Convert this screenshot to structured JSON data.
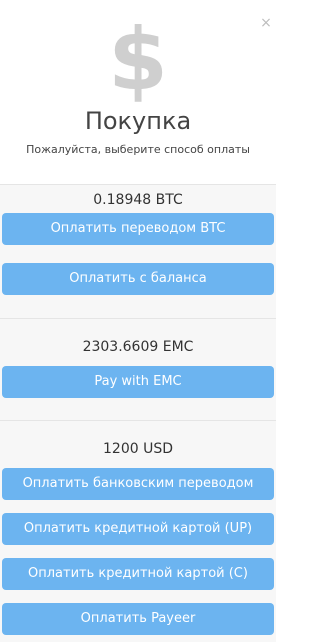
{
  "dialog": {
    "close_glyph": "×",
    "icon": "dollar-icon",
    "title": "Покупка",
    "subtitle": "Пожалуйста, выберите способ оплаты"
  },
  "btc": {
    "amount": "0.18948 BTC",
    "buttons": [
      "Оплатить переводом BTC",
      "Оплатить с баланса"
    ]
  },
  "emc": {
    "amount": "2303.6609 EMC",
    "buttons": [
      "Pay with EMC"
    ]
  },
  "usd": {
    "amount": "1200 USD",
    "buttons": [
      "Оплатить банковским переводом",
      "Оплатить кредитной картой (UP)",
      "Оплатить кредитной картой (C)",
      "Оплатить Payeer"
    ]
  },
  "colors": {
    "button_bg": "#6cb4f0",
    "button_text": "#ffffff",
    "section_bg": "#f7f7f7",
    "icon": "#cfcfcf"
  }
}
